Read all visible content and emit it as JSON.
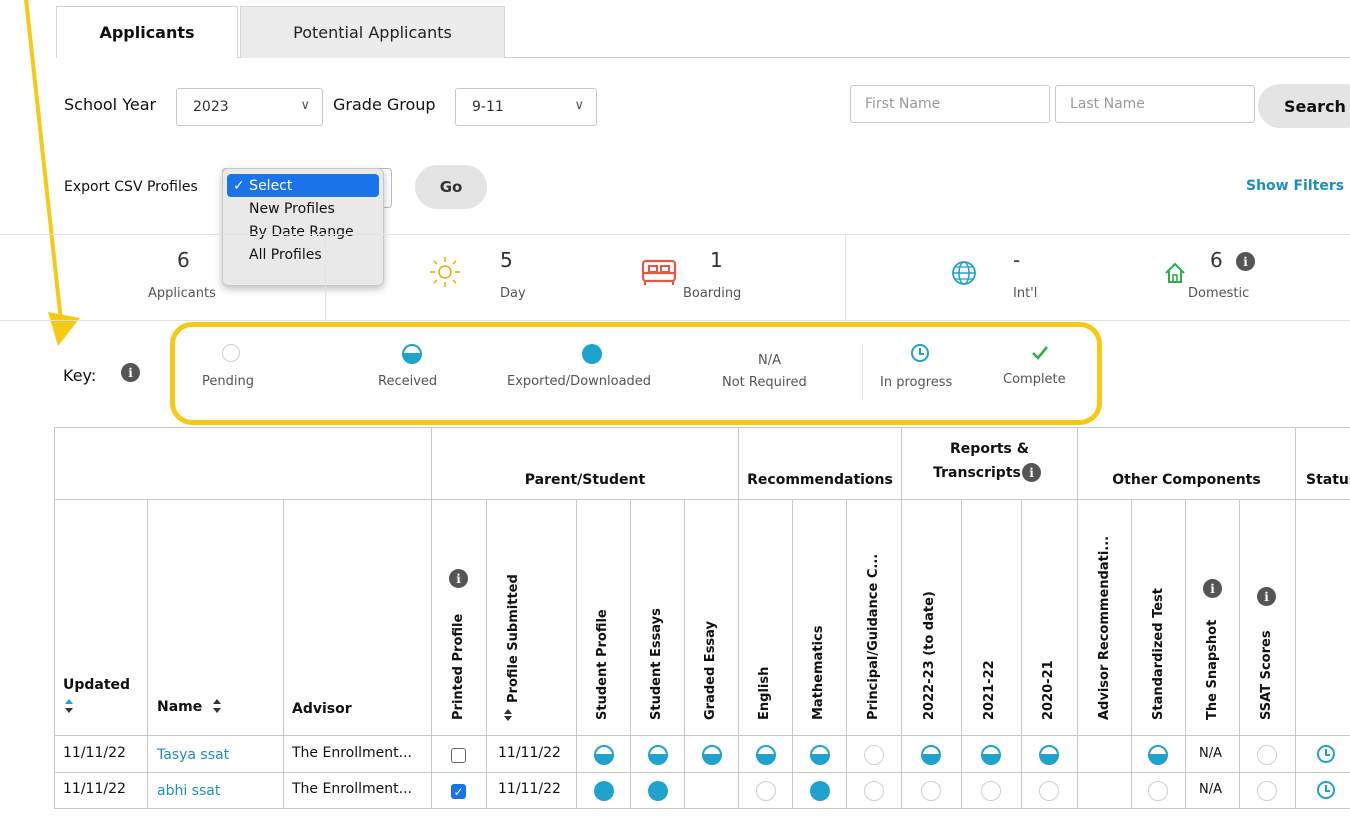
{
  "tabs": [
    {
      "label": "Applicants",
      "active": true
    },
    {
      "label": "Potential Applicants",
      "active": false
    }
  ],
  "filters": {
    "school_year_label": "School Year",
    "school_year_value": "2023",
    "grade_group_label": "Grade Group",
    "grade_group_value": "9-11",
    "first_name_placeholder": "First Name",
    "last_name_placeholder": "Last Name",
    "search_label": "Search"
  },
  "export": {
    "label": "Export CSV Profiles",
    "options": [
      "✓ Select",
      "New Profiles",
      "By Date Range",
      "All Profiles"
    ],
    "go_label": "Go",
    "show_filters_label": "Show Filters ∨"
  },
  "stats": [
    {
      "value": "6",
      "label": "Applicants",
      "icon": "people-icon"
    },
    {
      "value": "5",
      "label": "Day",
      "icon": "sun-icon"
    },
    {
      "value": "1",
      "label": "Boarding",
      "icon": "bed-icon"
    },
    {
      "value": "-",
      "label": "Int'l",
      "icon": "globe-icon"
    },
    {
      "value": "6",
      "label": "Domestic",
      "icon": "house-icon"
    }
  ],
  "key": {
    "label": "Key:",
    "items": [
      {
        "label": "Pending"
      },
      {
        "label": "Received"
      },
      {
        "label": "Exported/Downloaded"
      },
      {
        "symbol": "N/A",
        "label": "Not Required"
      },
      {
        "label": "In progress"
      },
      {
        "label": "Complete"
      }
    ]
  },
  "table": {
    "groups": [
      "Parent/Student",
      "Recommendations",
      "Reports &",
      "Transcripts",
      "Other Components",
      "Status"
    ],
    "columns": {
      "updated": "Updated",
      "name": "Name",
      "advisor": "Advisor",
      "rot": [
        "Printed Profile",
        "Profile Submitted",
        "Student Profile",
        "Student Essays",
        "Graded Essay",
        "English",
        "Mathematics",
        "Principal/Guidance C...",
        "2022-23 (to date)",
        "2021-22",
        "2020-21",
        "Advisor Recommendati...",
        "Standardized Test",
        "The Snapshot",
        "SSAT Scores"
      ]
    },
    "rows": [
      {
        "updated": "11/11/22",
        "name": "Tasya ssat",
        "advisor": "The Enrollment...",
        "printed": false,
        "submitted": "11/11/22",
        "snapshot": "N/A"
      },
      {
        "updated": "11/11/22",
        "name": "abhi ssat",
        "advisor": "The Enrollment...",
        "printed": true,
        "submitted": "11/11/22",
        "snapshot": "N/A"
      }
    ]
  },
  "colors": {
    "accent": "#1fa3cc",
    "highlight": "#f6c915",
    "link": "#1e8fbd"
  }
}
